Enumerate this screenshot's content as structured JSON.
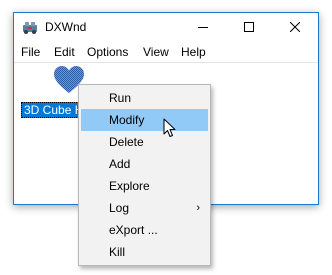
{
  "window": {
    "title": "DXWnd"
  },
  "menubar": {
    "items": [
      "File",
      "Edit",
      "Options",
      "View",
      "Help"
    ]
  },
  "list": {
    "selected_item_label": "3D Cube Hearts"
  },
  "context_menu": {
    "items": [
      "Run",
      "Modify",
      "Delete",
      "Add",
      "Explore",
      "Log",
      "eXport ...",
      "Kill"
    ],
    "highlighted_index": 1,
    "submenu_arrow": "›"
  },
  "colors": {
    "selection": "#0078d7",
    "menu_highlight": "#91c9f7",
    "menu_background": "#f2f2f2",
    "window_border": "#1979ca",
    "heart": "#3a6fb3"
  },
  "icons": {
    "app": "dxwnd-app-icon",
    "minimize": "minimize-icon",
    "maximize": "maximize-icon",
    "close": "close-icon",
    "list_item": "heart-icon",
    "cursor": "mouse-cursor-icon"
  }
}
